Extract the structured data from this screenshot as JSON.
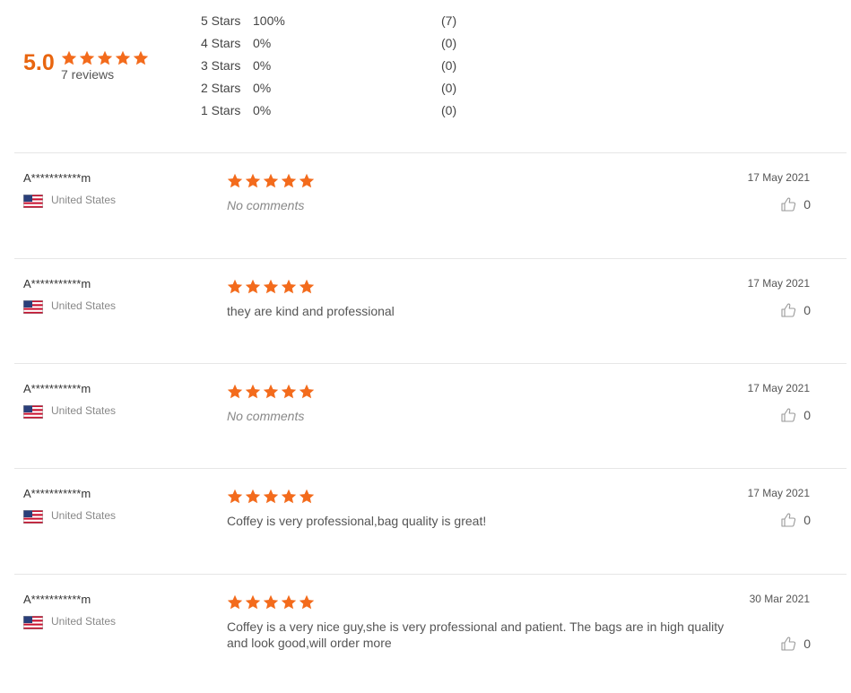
{
  "colors": {
    "star": "#f36b1c",
    "average": "#e8650f"
  },
  "summary": {
    "average": "5.0",
    "reviews_label": "7 reviews",
    "histogram": [
      {
        "label": "5 Stars",
        "percent": "100%",
        "count": "(7)"
      },
      {
        "label": "4 Stars",
        "percent": "0%",
        "count": "(0)"
      },
      {
        "label": "3 Stars",
        "percent": "0%",
        "count": "(0)"
      },
      {
        "label": "2 Stars",
        "percent": "0%",
        "count": "(0)"
      },
      {
        "label": "1 Stars",
        "percent": "0%",
        "count": "(0)"
      }
    ]
  },
  "reviews": [
    {
      "name": "A***********m",
      "country": "United States",
      "flag_icon": "us-flag-icon",
      "rating": 5,
      "comment": "No comments",
      "comment_empty": true,
      "date": "17 May 2021",
      "likes": "0",
      "like_icon": "thumbs-up-icon"
    },
    {
      "name": "A***********m",
      "country": "United States",
      "flag_icon": "us-flag-icon",
      "rating": 5,
      "comment": "they are kind and professional",
      "comment_empty": false,
      "date": "17 May 2021",
      "likes": "0",
      "like_icon": "thumbs-up-icon"
    },
    {
      "name": "A***********m",
      "country": "United States",
      "flag_icon": "us-flag-icon",
      "rating": 5,
      "comment": "No comments",
      "comment_empty": true,
      "date": "17 May 2021",
      "likes": "0",
      "like_icon": "thumbs-up-icon"
    },
    {
      "name": "A***********m",
      "country": "United States",
      "flag_icon": "us-flag-icon",
      "rating": 5,
      "comment": "Coffey is very professional,bag quality is great!",
      "comment_empty": false,
      "date": "17 May 2021",
      "likes": "0",
      "like_icon": "thumbs-up-icon"
    },
    {
      "name": "A***********m",
      "country": "United States",
      "flag_icon": "us-flag-icon",
      "rating": 5,
      "comment": "Coffey is a very nice guy,she is very professional and patient. The bags are in high quality and look good,will order more",
      "comment_empty": false,
      "date": "30 Mar 2021",
      "likes": "0",
      "like_icon": "thumbs-up-icon"
    }
  ]
}
